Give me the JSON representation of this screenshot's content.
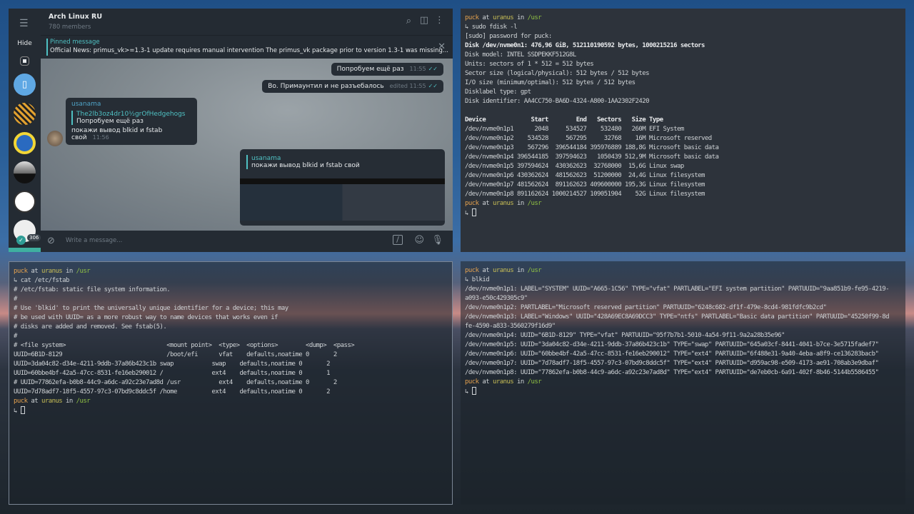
{
  "telegram": {
    "title": "Arch Linux RU",
    "members": "780 members",
    "hide_label": "Hide",
    "pinned_label": "Pinned message",
    "pinned_text": "Official News: primus_vk>=1.3-1 update requires manual intervention  The primus_vk package prior to version 1.3-1 was missing...",
    "badge": "306",
    "messages": [
      {
        "text": "Попробуем ещё раз",
        "time": "11:55"
      },
      {
        "text": "Во. Примаунтил и не разъебалось",
        "time": "edited 11:55"
      }
    ],
    "incoming": {
      "author": "usanama",
      "reply_author": "The2lb3oz4dr10½grOfHedgehogs",
      "reply_text": "Попробуем ещё раз",
      "text": "покажи вывод blkid и fstab свой",
      "time": "11:56"
    },
    "outgoing_reply": {
      "author": "usanama",
      "text": "покажи вывод blkid и fstab свой"
    },
    "input_placeholder": "Write a message...",
    "accent": "#4fc1c3"
  },
  "prompt": {
    "user": "puck",
    "at": " at ",
    "host": "uranus",
    "in": " in ",
    "dir": "/usr",
    "arrow": "↳ "
  },
  "terminals": {
    "fdisk": {
      "command": "sudo fdisk -l",
      "lines": [
        "[sudo] password for puck:",
        "Disk /dev/nvme0n1: 476,96 GiB, 512110190592 bytes, 1000215216 sectors",
        "Disk model: INTEL SSDPEKKF512G8L",
        "Units: sectors of 1 * 512 = 512 bytes",
        "Sector size (logical/physical): 512 bytes / 512 bytes",
        "I/O size (minimum/optimal): 512 bytes / 512 bytes",
        "Disklabel type: gpt",
        "Disk identifier: AA4CC750-BA6D-4324-A800-1AA2302F2420",
        "",
        "Device             Start        End   Sectors   Size Type",
        "/dev/nvme0n1p1      2048     534527    532480   260M EFI System",
        "/dev/nvme0n1p2    534528     567295     32768    16M Microsoft reserved",
        "/dev/nvme0n1p3    567296  396544184 395976889 188,8G Microsoft basic data",
        "/dev/nvme0n1p4 396544185  397594623   1050439 512,9M Microsoft basic data",
        "/dev/nvme0n1p5 397594624  430362623  32768000  15,6G Linux swap",
        "/dev/nvme0n1p6 430362624  481562623  51200000  24,4G Linux filesystem",
        "/dev/nvme0n1p7 481562624  891162623 409600000 195,3G Linux filesystem",
        "/dev/nvme0n1p8 891162624 1000214527 109051904    52G Linux filesystem"
      ]
    },
    "fstab": {
      "command": "cat /etc/fstab",
      "lines": [
        "# /etc/fstab: static file system information.",
        "#",
        "# Use 'blkid' to print the universally unique identifier for a device; this may",
        "# be used with UUID= as a more robust way to name devices that works even if",
        "# disks are added and removed. See fstab(5).",
        "#",
        "# <file system>                             <mount point>  <type>  <options>        <dump>  <pass>",
        "UUID=6B1D-8129                              /boot/efi      vfat    defaults,noatime 0       2",
        "UUID=3da04c82-d34e-4211-9ddb-37a86b423c1b swap           swap    defaults,noatime 0       2",
        "UUID=60bbe4bf-42a5-47cc-8531-fe16eb290012 /              ext4    defaults,noatime 0       1",
        "# UUID=77862efa-b0b8-44c9-a6dc-a92c23e7ad8d /usr           ext4    defaults,noatime 0       2",
        "UUID=7d78adf7-18f5-4557-97c3-07bd9c8ddc5f /home          ext4    defaults,noatime 0       2"
      ]
    },
    "blkid": {
      "command": "blkid",
      "lines": [
        "/dev/nvme0n1p1: LABEL=\"SYSTEM\" UUID=\"A665-1C56\" TYPE=\"vfat\" PARTLABEL=\"EFI system partition\" PARTUUID=\"9aa851b9-fe95-4219-",
        "a093-e50c429305c9\"",
        "/dev/nvme0n1p2: PARTLABEL=\"Microsoft reserved partition\" PARTUUID=\"6248c682-df1f-479e-8cd4-981fdfc9b2cd\"",
        "/dev/nvme0n1p3: LABEL=\"Windows\" UUID=\"428A69EC8A69DCC3\" TYPE=\"ntfs\" PARTLABEL=\"Basic data partition\" PARTUUID=\"45250f99-8d",
        "fe-4590-a833-3560279f16d9\"",
        "/dev/nvme0n1p4: UUID=\"6B1D-8129\" TYPE=\"vfat\" PARTUUID=\"95f7b7b1-5010-4a54-9f11-9a2a28b35e96\"",
        "/dev/nvme0n1p5: UUID=\"3da04c82-d34e-4211-9ddb-37a86b423c1b\" TYPE=\"swap\" PARTUUID=\"645a03cf-8441-4041-b7ce-3e5715fadef7\"",
        "/dev/nvme0n1p6: UUID=\"60bbe4bf-42a5-47cc-8531-fe16eb290012\" TYPE=\"ext4\" PARTUUID=\"6f488e31-9a40-4eba-a8f9-ce136283bacb\"",
        "/dev/nvme0n1p7: UUID=\"7d78adf7-18f5-4557-97c3-07bd9c8ddc5f\" TYPE=\"ext4\" PARTUUID=\"d959ac98-e509-4173-ae91-708ab3e9dbaf\"",
        "/dev/nvme0n1p8: UUID=\"77862efa-b0b8-44c9-a6dc-a92c23e7ad8d\" TYPE=\"ext4\" PARTUUID=\"de7eb0cb-6a91-402f-8b46-5144b5586455\""
      ]
    }
  }
}
